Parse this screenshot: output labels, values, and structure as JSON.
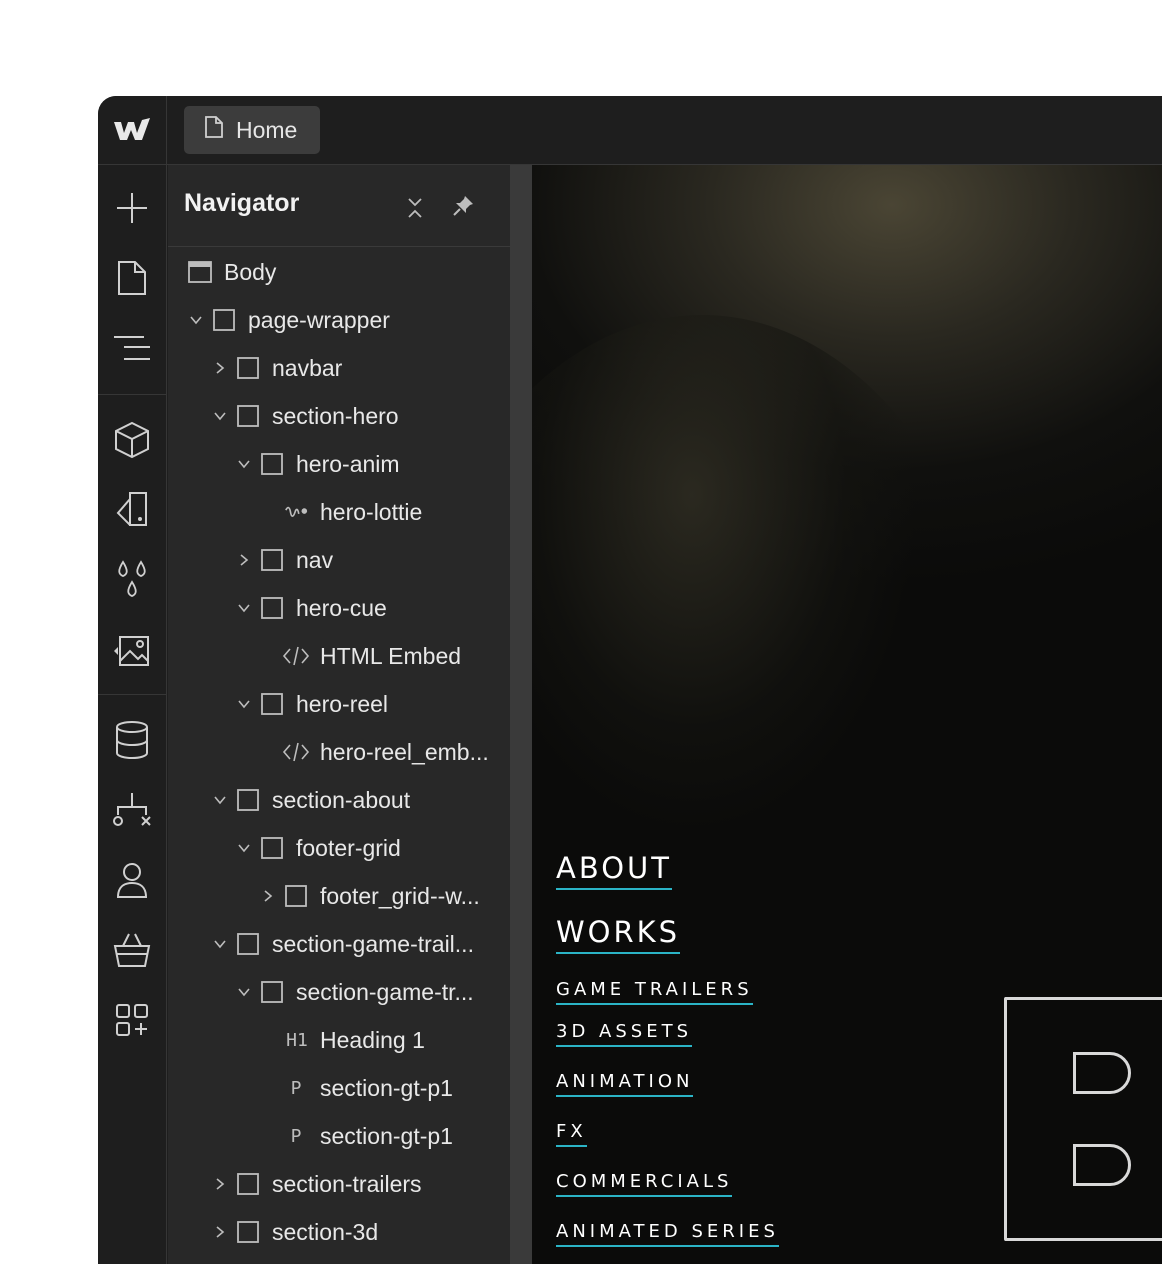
{
  "topbar": {
    "logo_icon": "webflow-logo-icon",
    "page_icon": "page-icon",
    "page_name": "Home"
  },
  "leftbar": {
    "icons": [
      "add-icon",
      "pages-icon",
      "navigator-icon",
      "components-icon",
      "styles-icon",
      "variables-icon",
      "assets-icon",
      "cms-icon",
      "logic-icon",
      "users-icon",
      "ecommerce-icon",
      "apps-icon"
    ]
  },
  "navigator": {
    "title": "Navigator",
    "collapse_icon": "collapse-icon",
    "pin_icon": "pin-icon",
    "items": [
      {
        "label": "Body",
        "type": "body"
      },
      {
        "label": "page-wrapper",
        "type": "div",
        "state": "expanded"
      },
      {
        "label": "navbar",
        "type": "div",
        "state": "collapsed"
      },
      {
        "label": "section-hero",
        "type": "div",
        "state": "expanded"
      },
      {
        "label": "hero-anim",
        "type": "div",
        "state": "expanded"
      },
      {
        "label": "hero-lottie",
        "type": "lottie"
      },
      {
        "label": "nav",
        "type": "div",
        "state": "collapsed"
      },
      {
        "label": "hero-cue",
        "type": "div",
        "state": "expanded"
      },
      {
        "label": "HTML Embed",
        "type": "embed"
      },
      {
        "label": "hero-reel",
        "type": "div",
        "state": "expanded"
      },
      {
        "label": "hero-reel_emb...",
        "type": "embed"
      },
      {
        "label": "section-about",
        "type": "div",
        "state": "expanded"
      },
      {
        "label": "footer-grid",
        "type": "div",
        "state": "expanded"
      },
      {
        "label": "footer_grid--w...",
        "type": "div",
        "state": "collapsed"
      },
      {
        "label": "section-game-trail...",
        "type": "div",
        "state": "expanded"
      },
      {
        "label": "section-game-tr...",
        "type": "div",
        "state": "expanded"
      },
      {
        "label": "Heading 1",
        "type": "heading",
        "tag": "H1"
      },
      {
        "label": "section-gt-p1",
        "type": "paragraph",
        "tag": "P"
      },
      {
        "label": "section-gt-p1",
        "type": "paragraph",
        "tag": "P"
      },
      {
        "label": "section-trailers",
        "type": "div",
        "state": "collapsed"
      },
      {
        "label": "section-3d",
        "type": "div",
        "state": "collapsed"
      }
    ]
  },
  "canvas": {
    "menu": {
      "about": "ABOUT",
      "works": "WORKS",
      "game_trailers": "GAME TRAILERS",
      "assets_3d": "3D ASSETS",
      "animation": "ANIMATION",
      "fx": "FX",
      "commercials": "COMMERCIALS",
      "animated_series": "ANIMATED SERIES"
    },
    "accent_color": "#2bb4c6"
  }
}
